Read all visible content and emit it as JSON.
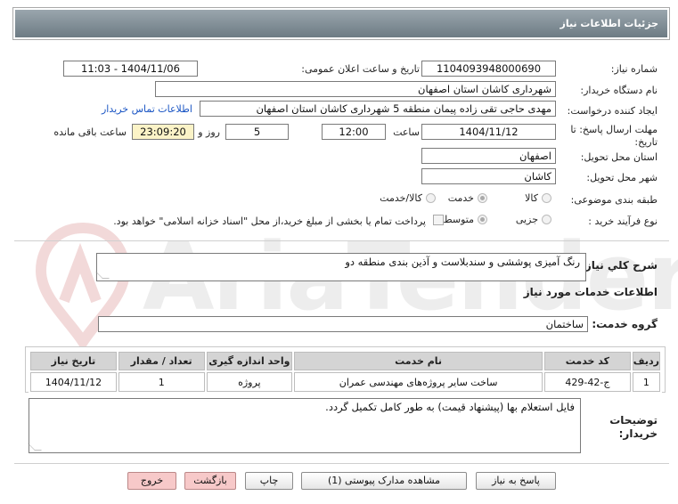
{
  "header": {
    "title": "جزئیات اطلاعات نیاز"
  },
  "watermark": {
    "text": "AriaTender.neT"
  },
  "fields": {
    "need_number_label": "شماره نیاز:",
    "need_number": "1104093948000690",
    "announce_label": "تاریخ و ساعت اعلان عمومی:",
    "announce_value": "1404/11/06 - 11:03",
    "buyer_org_label": "نام دستگاه خریدار:",
    "buyer_org": "شهرداری کاشان استان اصفهان",
    "requester_label": "ایجاد کننده درخواست:",
    "requester": "مهدی حاجی تقی زاده پیمان منطقه 5 شهرداری کاشان استان اصفهان",
    "buyer_contact_link": "اطلاعات تماس خریدار",
    "deadline_label_1": "مهلت ارسال پاسخ: تا",
    "deadline_label_2": "تاریخ:",
    "deadline_date": "1404/11/12",
    "time_label": "ساعت",
    "deadline_time": "12:00",
    "days_value": "5",
    "days_label": "روز و",
    "remaining_time": "23:09:20",
    "remaining_label": "ساعت باقی مانده",
    "province_label": "استان محل تحویل:",
    "province": "اصفهان",
    "city_label": "شهر محل تحویل:",
    "city": "کاشان",
    "category_label": "طبقه بندی موضوعی:",
    "category_options": [
      "کالا",
      "خدمت",
      "کالا/خدمت"
    ],
    "purchase_type_label": "نوع فرآیند خرید :",
    "purchase_options": [
      "جزیی",
      "متوسط"
    ],
    "payment_note": "پرداخت تمام یا بخشی از مبلغ خرید،از محل \"اسناد خزانه اسلامی\" خواهد بود."
  },
  "summary": {
    "label": "شرح کلي نياز:",
    "text": "رنگ آمیزی پوششی و سندبلاست و آذین بندی منطقه دو"
  },
  "services": {
    "section_title": "اطلاعات خدمات مورد نیاز",
    "group_label": "گروه خدمت:",
    "group_value": "ساختمان",
    "columns": [
      "ردیف",
      "کد خدمت",
      "نام خدمت",
      "واحد اندازه گیری",
      "تعداد / مقدار",
      "تاریخ نیاز"
    ],
    "rows": [
      [
        "1",
        "ج-42-429",
        "ساخت سایر پروژه‌های مهندسی عمران",
        "پروژه",
        "1",
        "1404/11/12"
      ]
    ]
  },
  "notes": {
    "label_1": "توضیحات",
    "label_2": "خریدار:",
    "text": "فایل استعلام بها (پیشنهاد قیمت) به طور کامل تکمیل گردد."
  },
  "buttons": {
    "reply": "پاسخ به نیاز",
    "attachments": "مشاهده مدارک پیوستی (1)",
    "print": "چاپ",
    "back": "بازگشت",
    "exit": "خروج"
  }
}
